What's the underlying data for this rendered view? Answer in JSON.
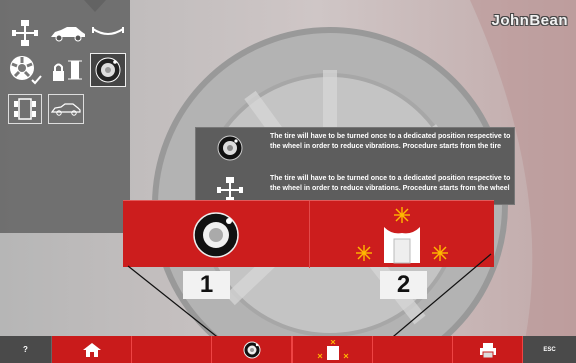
{
  "brand": "JohnBean",
  "side_menu": {
    "items": [
      {
        "name": "wheel-balancer",
        "icon": "wheel-balancer-icon"
      },
      {
        "name": "car",
        "icon": "car-icon"
      },
      {
        "name": "axle",
        "icon": "axle-icon"
      },
      {
        "name": "rim-check",
        "icon": "rim-check-icon"
      },
      {
        "name": "lock-position",
        "icon": "lock-position-icon"
      },
      {
        "name": "tire-matching",
        "icon": "tire-matching-icon",
        "selected": true
      },
      {
        "name": "car-top-view",
        "icon": "car-top-view-icon"
      },
      {
        "name": "car-side-view",
        "icon": "car-side-view-icon"
      }
    ]
  },
  "info": {
    "rows": [
      {
        "icon": "tire-icon",
        "text": "The tire will have to be turned once to a dedicated position respective to the wheel in order to reduce vibrations. Procedure starts from the tire"
      },
      {
        "icon": "wheel-icon",
        "text": "The tire will have to be turned once to a dedicated position respective to the wheel in order to reduce vibrations. Procedure starts from the wheel"
      }
    ]
  },
  "choices": [
    {
      "number": "1",
      "icon": "tire-icon"
    },
    {
      "number": "2",
      "icon": "wheel-weight-icon"
    }
  ],
  "bottom_bar": {
    "help_label": "?",
    "esc_label": "ESC",
    "buttons": [
      "help",
      "home",
      "empty-1",
      "tire",
      "empty-2",
      "wheel",
      "empty-3",
      "print",
      "esc"
    ]
  },
  "colors": {
    "accent": "#cc1d1d",
    "panel": "#696969",
    "dialog": "#5d5d5d"
  }
}
